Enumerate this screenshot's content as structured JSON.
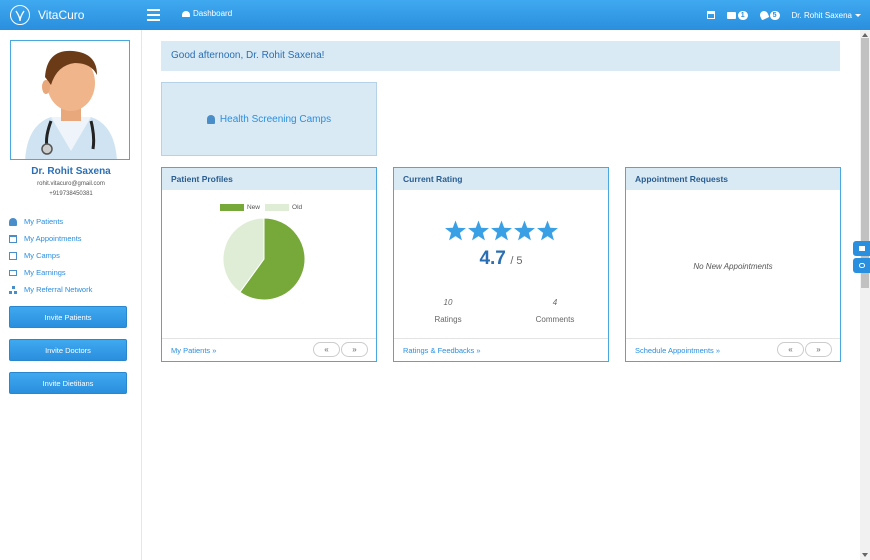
{
  "app": {
    "name": "VitaCuro"
  },
  "topbar": {
    "dashboard_label": "Dashboard",
    "messages_count": "1",
    "notifications_count": "5",
    "user_name": "Dr. Rohit Saxena"
  },
  "profile": {
    "name": "Dr. Rohit Saxena",
    "email": "rohit.vitacuro@gmail.com",
    "phone": "+919738450381"
  },
  "sidebar": {
    "items": [
      {
        "label": "My Patients",
        "icon": "user-icon"
      },
      {
        "label": "My Appointments",
        "icon": "calendar-icon"
      },
      {
        "label": "My Camps",
        "icon": "document-icon"
      },
      {
        "label": "My Earnings",
        "icon": "credit-card-icon"
      },
      {
        "label": "My Referral Network",
        "icon": "sitemap-icon"
      }
    ],
    "buttons": [
      "Invite Patients",
      "Invite Doctors",
      "Invite Dietitians"
    ]
  },
  "main": {
    "greeting": "Good afternoon, Dr. Rohit Saxena!",
    "camp_button": "Health Screening Camps",
    "panels": {
      "profiles": {
        "title": "Patient Profiles",
        "footer_link": "My Patients",
        "legend": [
          "New",
          "Old"
        ],
        "pager_prev": "«",
        "pager_next": "»"
      },
      "rating": {
        "title": "Current Rating",
        "value": "4.7",
        "max": "/ 5",
        "stars": 4.7,
        "ratings_count": "10",
        "ratings_label": "Ratings",
        "comments_count": "4",
        "comments_label": "Comments",
        "footer_link": "Ratings & Feedbacks"
      },
      "appointments": {
        "title": "Appointment Requests",
        "empty_text": "No New Appointments",
        "footer_link": "Schedule Appointments",
        "pager_prev": "«",
        "pager_next": "»"
      }
    }
  },
  "chart_data": {
    "type": "pie",
    "categories": [
      "New",
      "Old"
    ],
    "values": [
      60,
      40
    ],
    "colors": [
      "#77a83a",
      "#dfecd6"
    ],
    "title": "",
    "legend": "top"
  },
  "colors": {
    "accent": "#2a8fde",
    "panel_header": "#d9eaf5"
  }
}
